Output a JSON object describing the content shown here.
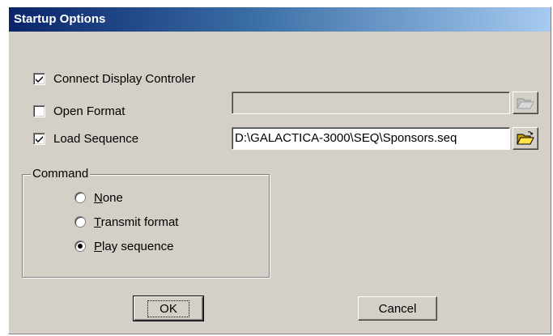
{
  "window": {
    "title": "Startup Options"
  },
  "options": {
    "connect_display": {
      "label": "Connect Display Controler",
      "checked": true
    },
    "open_format": {
      "label": "Open Format",
      "checked": false,
      "path": ""
    },
    "load_sequence": {
      "label": "Load Sequence",
      "checked": true,
      "path": "D:\\GALACTICA-3000\\SEQ\\Sponsors.seq"
    }
  },
  "command": {
    "label": "Command",
    "options": [
      {
        "mnemonic": "N",
        "rest": "one",
        "selected": false
      },
      {
        "mnemonic": "T",
        "rest": "ransmit format",
        "selected": false
      },
      {
        "mnemonic": "P",
        "rest": "lay sequence",
        "selected": true
      }
    ]
  },
  "buttons": {
    "ok": "OK",
    "cancel": "Cancel"
  },
  "icons": {
    "browse": "open-folder-icon",
    "check": "check-icon"
  }
}
